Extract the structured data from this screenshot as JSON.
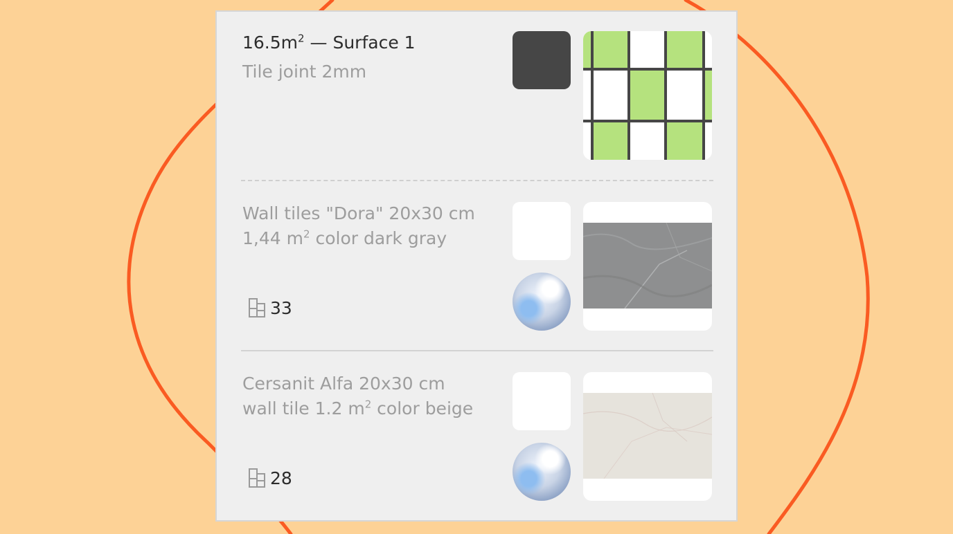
{
  "surface": {
    "area_value": "16.5m",
    "area_unit_sup": "2",
    "name": " — Surface 1",
    "joint_label": "Tile joint 2mm",
    "joint_color": "#464646",
    "pattern_colors": {
      "green": "#b5e27e",
      "white": "#ffffff",
      "grout": "#464646"
    }
  },
  "tiles": [
    {
      "line1": "Wall tiles \"Dora\" 20x30 cm",
      "line2_pre": "1,44 m",
      "line2_sup": "2",
      "line2_post": " color dark gray",
      "count": "33",
      "count_icon": "tiles-layout-icon",
      "finish_icon": "glossy-sphere-icon",
      "texture_color": "#8e8f90"
    },
    {
      "line1": "Cersanit Alfa 20x30 cm",
      "line2_pre": "wall tile 1.2 m",
      "line2_sup": "2",
      "line2_post": " color beige",
      "count": "28",
      "count_icon": "tiles-layout-icon",
      "finish_icon": "glossy-sphere-icon",
      "texture_color": "#e6e3dc"
    }
  ],
  "colors": {
    "background": "#fdd296",
    "blob_stroke": "#fa5b22",
    "panel": "#efefef"
  }
}
